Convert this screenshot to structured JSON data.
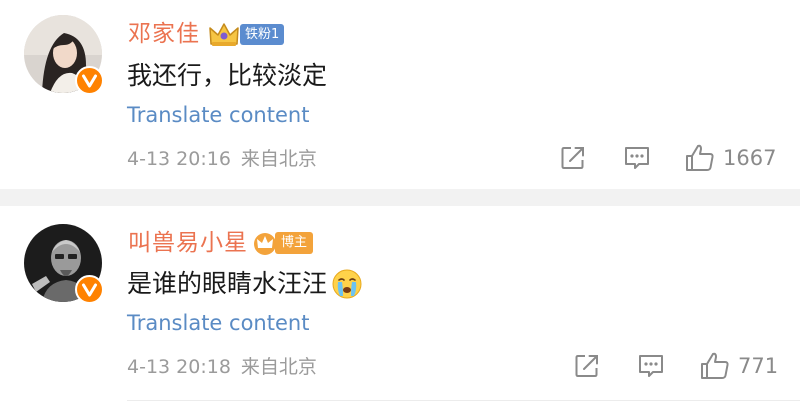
{
  "comments": [
    {
      "username": "邓家佳",
      "badge": "铁粉1",
      "text": "我还行，比较淡定",
      "translate_label": "Translate content",
      "date": "4-13 20:16",
      "location": "来自北京",
      "likes": "1667"
    },
    {
      "username": "叫兽易小星",
      "badge": "博主",
      "text": "是谁的眼睛水汪汪",
      "translate_label": "Translate content",
      "date": "4-13 20:18",
      "location": "来自北京",
      "likes": "771"
    }
  ],
  "icons": {
    "share": "share-icon",
    "reply": "comment-icon",
    "like": "thumbs-up-icon",
    "verified": "verified-badge-icon",
    "crown": "crown-icon",
    "emoji": "crying-face-emoji"
  },
  "colors": {
    "username": "#eb7350",
    "link": "#5a8bc4",
    "meta": "#9b9b9b",
    "verified": "#ff8200",
    "fan_badge": "#5b8ccf",
    "blogger_badge": "#f3a33b",
    "separator": "#f2f2f2"
  }
}
